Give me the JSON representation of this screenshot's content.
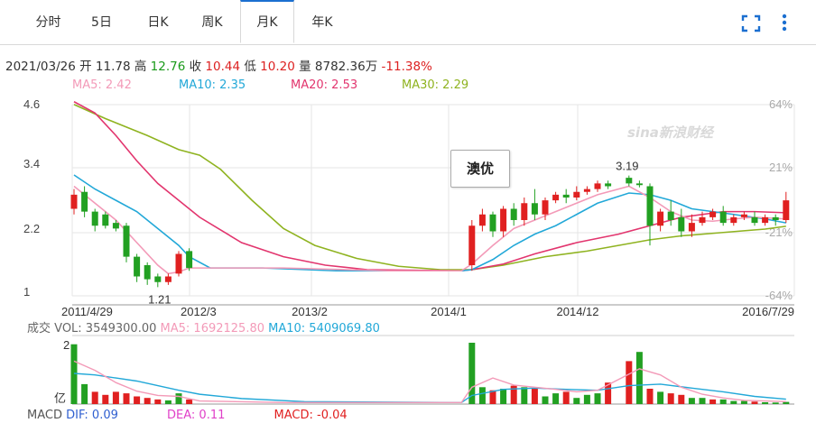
{
  "tabs": [
    {
      "label": "分时"
    },
    {
      "label": "5日"
    },
    {
      "label": "日K"
    },
    {
      "label": "周K"
    },
    {
      "label": "月K"
    },
    {
      "label": "年K"
    }
  ],
  "active_tab": "月K",
  "info": {
    "date": "2021/03/26",
    "open_label": "开",
    "open": "11.78",
    "high_label": "高",
    "high": "12.76",
    "close_label": "收",
    "close": "10.44",
    "low_label": "低",
    "low": "10.20",
    "vol_label": "量",
    "vol": "8782.36万",
    "change": "-11.38%"
  },
  "ma_legend": [
    {
      "label": "MA5: 2.42",
      "color": "#f39ab8"
    },
    {
      "label": "MA10: 2.35",
      "color": "#22a8d8"
    },
    {
      "label": "MA20: 2.53",
      "color": "#e2356e"
    },
    {
      "label": "MA30: 2.29",
      "color": "#8fb320"
    }
  ],
  "watermark": "sina新浪财经",
  "bubble": "澳优",
  "vol_legend": {
    "title": "成交",
    "vol": "VOL: 3549300.00",
    "ma5": "MA5: 1692125.80",
    "ma10": "MA10: 5409069.80"
  },
  "macd_legend": {
    "title": "MACD",
    "dif": "DIF: 0.09",
    "dea": "DEA: 0.11",
    "macd": "MACD: -0.04"
  },
  "colors": {
    "up": "#e02020",
    "down": "#22a022",
    "ma5": "#f39ab8",
    "ma10": "#22a8d8",
    "ma20": "#e2356e",
    "ma30": "#8fb320",
    "accent": "#1b6fd0"
  },
  "chart_data": {
    "type": "candlestick",
    "y_ticks_left": [
      "4.6",
      "3.4",
      "2.2",
      "1"
    ],
    "y_ticks_right": [
      "64%",
      "21%",
      "-21%",
      "-64%"
    ],
    "x_labels": [
      "2011/4/29",
      "2012/3",
      "2013/2",
      "2014/1",
      "2014/12",
      "2016/7/29"
    ],
    "annotations": [
      {
        "text": "3.19"
      },
      {
        "text": "1.21"
      }
    ],
    "candles": [
      [
        0,
        2.6,
        2.85,
        2.95,
        2.5
      ],
      [
        1,
        2.9,
        2.55,
        3.0,
        2.45
      ],
      [
        2,
        2.55,
        2.3,
        2.6,
        2.2
      ],
      [
        3,
        2.5,
        2.3,
        2.55,
        2.25
      ],
      [
        4,
        2.35,
        2.25,
        2.4,
        2.2
      ],
      [
        5,
        2.3,
        1.75,
        2.35,
        1.65
      ],
      [
        6,
        1.75,
        1.4,
        1.8,
        1.3
      ],
      [
        7,
        1.6,
        1.35,
        1.65,
        1.25
      ],
      [
        8,
        1.4,
        1.3,
        1.45,
        1.21
      ],
      [
        9,
        1.3,
        1.4,
        1.45,
        1.25
      ],
      [
        10,
        1.45,
        1.8,
        1.85,
        1.4
      ],
      [
        11,
        1.85,
        1.55,
        1.9,
        1.5
      ],
      [
        38,
        1.6,
        2.3,
        2.4,
        1.5
      ],
      [
        39,
        2.3,
        2.5,
        2.6,
        2.2
      ],
      [
        40,
        2.5,
        2.2,
        2.55,
        2.1
      ],
      [
        41,
        2.2,
        2.6,
        2.65,
        2.1
      ],
      [
        42,
        2.6,
        2.4,
        2.7,
        2.3
      ],
      [
        43,
        2.4,
        2.7,
        2.8,
        2.3
      ],
      [
        44,
        2.7,
        2.5,
        2.95,
        2.4
      ],
      [
        45,
        2.5,
        2.75,
        2.8,
        2.4
      ],
      [
        46,
        2.75,
        2.85,
        2.9,
        2.7
      ],
      [
        47,
        2.85,
        2.8,
        2.95,
        2.7
      ],
      [
        48,
        2.8,
        2.9,
        3.0,
        2.75
      ],
      [
        49,
        2.9,
        2.95,
        3.0,
        2.85
      ],
      [
        50,
        2.95,
        3.05,
        3.1,
        2.9
      ],
      [
        51,
        3.05,
        3.0,
        3.1,
        2.95
      ],
      [
        53,
        3.15,
        3.05,
        3.19,
        3.0
      ],
      [
        54,
        3.05,
        3.02,
        3.1,
        2.98
      ],
      [
        55,
        3.0,
        2.3,
        3.05,
        1.95
      ],
      [
        56,
        2.3,
        2.55,
        2.6,
        2.2
      ],
      [
        57,
        2.55,
        2.4,
        2.75,
        2.3
      ],
      [
        58,
        2.45,
        2.2,
        2.6,
        2.1
      ],
      [
        59,
        2.2,
        2.35,
        2.5,
        2.1
      ],
      [
        60,
        2.35,
        2.45,
        2.55,
        2.3
      ],
      [
        61,
        2.45,
        2.55,
        2.6,
        2.4
      ],
      [
        62,
        2.55,
        2.35,
        2.65,
        2.3
      ],
      [
        63,
        2.35,
        2.45,
        2.5,
        2.3
      ],
      [
        64,
        2.45,
        2.5,
        2.55,
        2.4
      ],
      [
        65,
        2.45,
        2.35,
        2.55,
        2.3
      ],
      [
        66,
        2.35,
        2.45,
        2.5,
        2.3
      ],
      [
        67,
        2.45,
        2.4,
        2.5,
        2.3
      ],
      [
        68,
        2.4,
        2.75,
        2.9,
        2.35
      ]
    ],
    "ma_points": {
      "ma5": [
        [
          0,
          3.0
        ],
        [
          2,
          2.7
        ],
        [
          4,
          2.4
        ],
        [
          6,
          2.0
        ],
        [
          8,
          1.6
        ],
        [
          9,
          1.45
        ],
        [
          10,
          1.48
        ],
        [
          11,
          1.55
        ],
        [
          13,
          1.55
        ],
        [
          20,
          1.55
        ],
        [
          30,
          1.5
        ],
        [
          37,
          1.5
        ],
        [
          38,
          1.62
        ],
        [
          40,
          1.95
        ],
        [
          42,
          2.25
        ],
        [
          44,
          2.4
        ],
        [
          46,
          2.55
        ],
        [
          48,
          2.7
        ],
        [
          50,
          2.85
        ],
        [
          53,
          3.0
        ],
        [
          55,
          2.8
        ],
        [
          57,
          2.55
        ],
        [
          59,
          2.4
        ],
        [
          61,
          2.38
        ],
        [
          63,
          2.42
        ],
        [
          65,
          2.45
        ],
        [
          68,
          2.42
        ]
      ],
      "ma10": [
        [
          0,
          3.2
        ],
        [
          2,
          2.95
        ],
        [
          4,
          2.75
        ],
        [
          6,
          2.55
        ],
        [
          8,
          2.25
        ],
        [
          10,
          1.95
        ],
        [
          11,
          1.75
        ],
        [
          13,
          1.55
        ],
        [
          18,
          1.55
        ],
        [
          25,
          1.5
        ],
        [
          37,
          1.5
        ],
        [
          38,
          1.52
        ],
        [
          40,
          1.7
        ],
        [
          42,
          1.95
        ],
        [
          44,
          2.15
        ],
        [
          46,
          2.3
        ],
        [
          48,
          2.5
        ],
        [
          50,
          2.7
        ],
        [
          53,
          2.88
        ],
        [
          55,
          2.85
        ],
        [
          57,
          2.75
        ],
        [
          59,
          2.6
        ],
        [
          61,
          2.55
        ],
        [
          63,
          2.5
        ],
        [
          66,
          2.42
        ],
        [
          68,
          2.35
        ]
      ],
      "ma20": [
        [
          0,
          4.5
        ],
        [
          2,
          4.3
        ],
        [
          4,
          3.9
        ],
        [
          6,
          3.45
        ],
        [
          8,
          3.05
        ],
        [
          10,
          2.75
        ],
        [
          12,
          2.45
        ],
        [
          16,
          2.0
        ],
        [
          20,
          1.75
        ],
        [
          24,
          1.6
        ],
        [
          28,
          1.52
        ],
        [
          37,
          1.5
        ],
        [
          38,
          1.52
        ],
        [
          41,
          1.62
        ],
        [
          44,
          1.8
        ],
        [
          48,
          2.0
        ],
        [
          52,
          2.15
        ],
        [
          55,
          2.3
        ],
        [
          58,
          2.45
        ],
        [
          62,
          2.55
        ],
        [
          65,
          2.55
        ],
        [
          68,
          2.53
        ]
      ],
      "ma30": [
        [
          0,
          4.45
        ],
        [
          3,
          4.2
        ],
        [
          7,
          3.9
        ],
        [
          10,
          3.65
        ],
        [
          12,
          3.55
        ],
        [
          14,
          3.3
        ],
        [
          17,
          2.75
        ],
        [
          20,
          2.25
        ],
        [
          23,
          1.95
        ],
        [
          27,
          1.72
        ],
        [
          31,
          1.58
        ],
        [
          35,
          1.52
        ],
        [
          38,
          1.52
        ],
        [
          41,
          1.6
        ],
        [
          45,
          1.75
        ],
        [
          49,
          1.85
        ],
        [
          52,
          1.95
        ],
        [
          55,
          2.05
        ],
        [
          58,
          2.12
        ],
        [
          62,
          2.18
        ],
        [
          66,
          2.24
        ],
        [
          68,
          2.29
        ]
      ]
    },
    "volume": [
      [
        0,
        1.95,
        0
      ],
      [
        1,
        0.65,
        0
      ],
      [
        2,
        0.4,
        1
      ],
      [
        3,
        0.3,
        1
      ],
      [
        4,
        0.4,
        1
      ],
      [
        5,
        0.35,
        1
      ],
      [
        6,
        0.25,
        1
      ],
      [
        7,
        0.2,
        1
      ],
      [
        8,
        0.15,
        1
      ],
      [
        9,
        0.12,
        0
      ],
      [
        10,
        0.35,
        0
      ],
      [
        11,
        0.15,
        1
      ],
      [
        38,
        2.0,
        0
      ],
      [
        39,
        0.55,
        0
      ],
      [
        40,
        0.45,
        1
      ],
      [
        41,
        0.5,
        0
      ],
      [
        42,
        0.6,
        1
      ],
      [
        43,
        0.55,
        0
      ],
      [
        44,
        0.5,
        1
      ],
      [
        45,
        0.25,
        0
      ],
      [
        46,
        0.35,
        0
      ],
      [
        47,
        0.4,
        1
      ],
      [
        48,
        0.2,
        0
      ],
      [
        49,
        0.3,
        0
      ],
      [
        50,
        0.35,
        0
      ],
      [
        51,
        0.7,
        1
      ],
      [
        53,
        1.4,
        1
      ],
      [
        54,
        1.7,
        0
      ],
      [
        55,
        0.5,
        1
      ],
      [
        56,
        0.4,
        0
      ],
      [
        57,
        0.35,
        1
      ],
      [
        58,
        0.3,
        1
      ],
      [
        59,
        0.2,
        0
      ],
      [
        60,
        0.2,
        0
      ],
      [
        61,
        0.15,
        1
      ],
      [
        62,
        0.15,
        0
      ],
      [
        63,
        0.1,
        0
      ],
      [
        64,
        0.1,
        0
      ],
      [
        65,
        0.08,
        1
      ],
      [
        66,
        0.06,
        0
      ],
      [
        67,
        0.05,
        0
      ],
      [
        68,
        0.07,
        0
      ]
    ],
    "vol_ma5": [
      [
        0,
        1.4
      ],
      [
        2,
        1.1
      ],
      [
        4,
        0.7
      ],
      [
        6,
        0.42
      ],
      [
        8,
        0.28
      ],
      [
        10,
        0.25
      ],
      [
        12,
        0.1
      ],
      [
        20,
        0.05
      ],
      [
        37,
        0.05
      ],
      [
        38,
        0.55
      ],
      [
        40,
        0.85
      ],
      [
        42,
        0.62
      ],
      [
        44,
        0.55
      ],
      [
        46,
        0.48
      ],
      [
        48,
        0.4
      ],
      [
        50,
        0.45
      ],
      [
        52,
        0.8
      ],
      [
        54,
        1.15
      ],
      [
        56,
        0.95
      ],
      [
        58,
        0.55
      ],
      [
        60,
        0.32
      ],
      [
        62,
        0.2
      ],
      [
        64,
        0.12
      ],
      [
        66,
        0.1
      ],
      [
        68,
        0.08
      ]
    ],
    "vol_ma10": [
      [
        0,
        1.0
      ],
      [
        2,
        0.95
      ],
      [
        4,
        0.85
      ],
      [
        6,
        0.75
      ],
      [
        8,
        0.6
      ],
      [
        10,
        0.45
      ],
      [
        12,
        0.32
      ],
      [
        16,
        0.18
      ],
      [
        22,
        0.08
      ],
      [
        37,
        0.05
      ],
      [
        38,
        0.28
      ],
      [
        41,
        0.48
      ],
      [
        44,
        0.52
      ],
      [
        47,
        0.48
      ],
      [
        50,
        0.45
      ],
      [
        53,
        0.6
      ],
      [
        56,
        0.65
      ],
      [
        59,
        0.52
      ],
      [
        62,
        0.4
      ],
      [
        65,
        0.25
      ],
      [
        68,
        0.16
      ]
    ]
  }
}
